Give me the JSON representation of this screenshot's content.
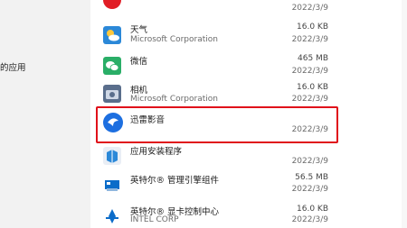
{
  "left_pane": {
    "label": "的应用"
  },
  "apps": [
    {
      "name": "",
      "publisher": "",
      "size": "",
      "date": "2022/3/9",
      "icon": "red-app-icon"
    },
    {
      "name": "天气",
      "publisher": "Microsoft Corporation",
      "size": "16.0 KB",
      "date": "2022/3/9",
      "icon": "weather-icon"
    },
    {
      "name": "微信",
      "publisher": "",
      "size": "465 MB",
      "date": "2022/3/9",
      "icon": "wechat-icon"
    },
    {
      "name": "相机",
      "publisher": "Microsoft Corporation",
      "size": "16.0 KB",
      "date": "2022/3/9",
      "icon": "camera-icon"
    },
    {
      "name": "迅雷影音",
      "publisher": "",
      "size": "",
      "date": "2022/3/9",
      "icon": "xunlei-player-icon"
    },
    {
      "name": "应用安装程序",
      "publisher": "",
      "size": "",
      "date": "2022/3/9",
      "icon": "app-installer-icon"
    },
    {
      "name": "英特尔® 管理引擎组件",
      "publisher": "",
      "size": "56.5 MB",
      "date": "2022/3/9",
      "icon": "intel-me-icon"
    },
    {
      "name": "英特尔® 显卡控制中心",
      "publisher": "INTEL CORP",
      "size": "16.0 KB",
      "date": "2022/3/9",
      "icon": "intel-graphics-icon"
    }
  ],
  "colors": {
    "highlight": "#e0101a",
    "accent": "#0078d4"
  }
}
